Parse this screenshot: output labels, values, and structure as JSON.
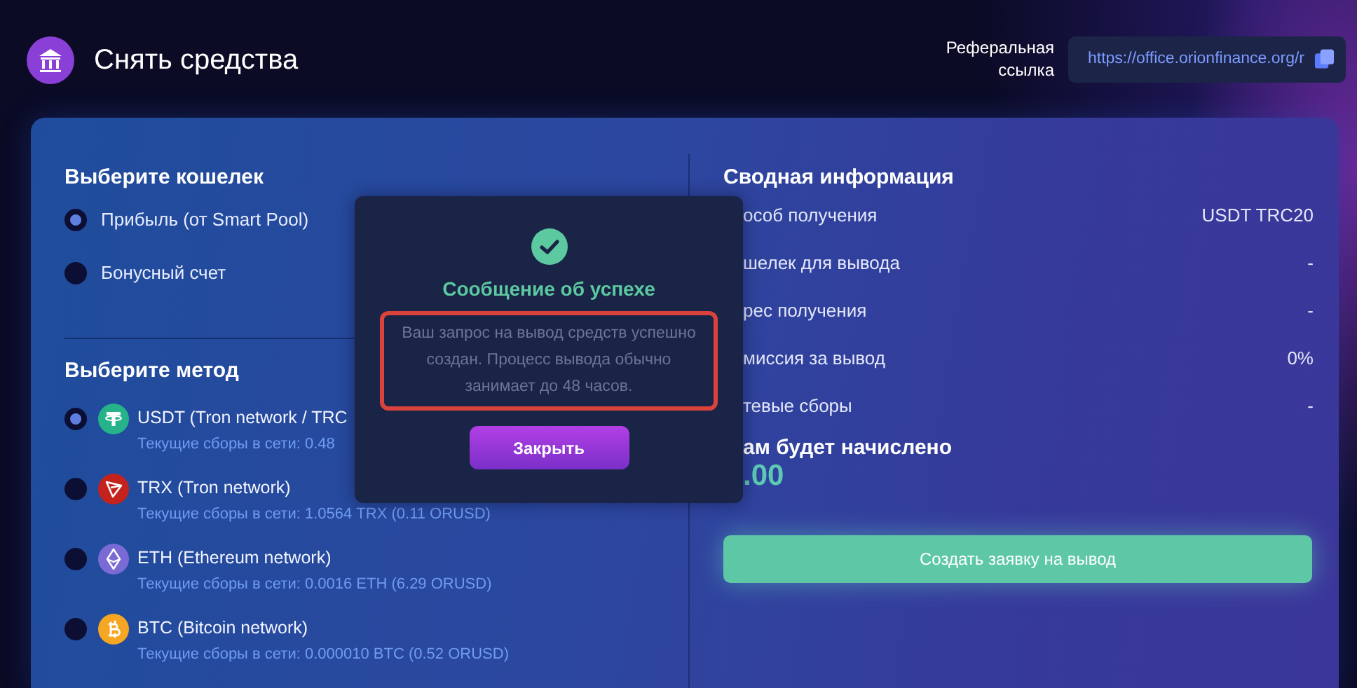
{
  "header": {
    "title": "Снять средства",
    "referral_label": "Реферальная ссылка",
    "referral_link": "https://office.orionfinance.org/r"
  },
  "wallet_section": {
    "title": "Выберите кошелек",
    "options": [
      {
        "label": "Прибыль (от Smart Pool)",
        "selected": true
      },
      {
        "label": "Бонусный счет",
        "selected": false
      }
    ]
  },
  "method_section": {
    "title": "Выберите метод",
    "methods": [
      {
        "kind": "usdt",
        "name": "USDT (Tron network / TRC",
        "fee": "Текущие сборы в сети: 0.48",
        "selected": true
      },
      {
        "kind": "trx",
        "name": "TRX (Tron network)",
        "fee": "Текущие сборы в сети: 1.0564 TRX (0.11 ORUSD)",
        "selected": false
      },
      {
        "kind": "eth",
        "name": "ETH (Ethereum network)",
        "fee": "Текущие сборы в сети: 0.0016 ETH (6.29 ORUSD)",
        "selected": false
      },
      {
        "kind": "btc",
        "name": "BTC (Bitcoin network)",
        "fee": "Текущие сборы в сети: 0.000010 BTC (0.52 ORUSD)",
        "selected": false
      }
    ]
  },
  "summary": {
    "title": "Сводная информация",
    "rows": [
      {
        "label": "особ получения",
        "value": "USDT TRC20"
      },
      {
        "label": "шелек для вывода",
        "value": "-"
      },
      {
        "label": "рес получения",
        "value": "-"
      },
      {
        "label": "миссия за вывод",
        "value": "0%"
      },
      {
        "label": "тевые сборы",
        "value": "-"
      }
    ],
    "total_label": "ам будет начислено",
    "total_value": ".00",
    "submit_button": "Создать заявку на вывод"
  },
  "modal": {
    "title": "Сообщение об успехе",
    "message": "Ваш запрос на вывод средств успешно создан. Процесс вывода обычно занимает до 48 часов.",
    "close_button": "Закрыть"
  }
}
